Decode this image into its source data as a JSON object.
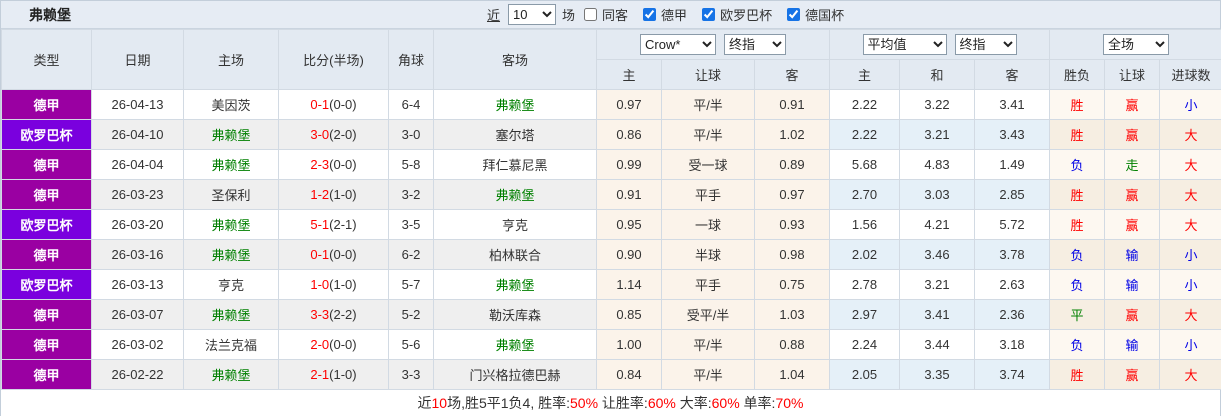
{
  "title": "弗赖堡",
  "toolbar": {
    "near_label": "近",
    "match_count": "10",
    "matches_label": "场",
    "same_away": {
      "label": "同客",
      "checked": false
    },
    "leagues": [
      {
        "label": "德甲",
        "checked": true
      },
      {
        "label": "欧罗巴杯",
        "checked": true
      },
      {
        "label": "德国杯",
        "checked": true
      }
    ]
  },
  "header": {
    "selects": {
      "company": "Crow*",
      "company_stage": "终指",
      "average": "平均值",
      "average_stage": "终指",
      "scope": "全场"
    },
    "columns": {
      "type": "类型",
      "date": "日期",
      "home": "主场",
      "score": "比分(半场)",
      "corner": "角球",
      "away": "客场",
      "odds_home": "主",
      "odds_handicap": "让球",
      "odds_away": "客",
      "avg_home": "主",
      "avg_draw": "和",
      "avg_away": "客",
      "wdl": "胜负",
      "cover": "让球",
      "goals": "进球数"
    }
  },
  "rows": [
    {
      "league": "德甲",
      "league_class": "lg-a",
      "date": "26-04-13",
      "home": "美因茨",
      "home_class": "",
      "score": "0-1",
      "half": "(0-0)",
      "corners": "6-4",
      "away": "弗赖堡",
      "away_class": "team-self",
      "odds_home": "0.97",
      "handicap": "平/半",
      "odds_away": "0.91",
      "avg_home": "2.22",
      "avg_draw": "3.22",
      "avg_away": "3.41",
      "wdl": "胜",
      "wdl_class": "c-red",
      "cover": "赢",
      "cover_class": "c-red",
      "goals": "小",
      "goals_class": "c-blue"
    },
    {
      "league": "欧罗巴杯",
      "league_class": "lg-b",
      "date": "26-04-10",
      "home": "弗赖堡",
      "home_class": "team-self",
      "score": "3-0",
      "half": "(2-0)",
      "corners": "3-0",
      "away": "塞尔塔",
      "away_class": "",
      "odds_home": "0.86",
      "handicap": "平/半",
      "odds_away": "1.02",
      "avg_home": "2.22",
      "avg_draw": "3.21",
      "avg_away": "3.43",
      "wdl": "胜",
      "wdl_class": "c-red",
      "cover": "赢",
      "cover_class": "c-red",
      "goals": "大",
      "goals_class": "c-red"
    },
    {
      "league": "德甲",
      "league_class": "lg-a",
      "date": "26-04-04",
      "home": "弗赖堡",
      "home_class": "team-self",
      "score": "2-3",
      "half": "(0-0)",
      "corners": "5-8",
      "away": "拜仁慕尼黑",
      "away_class": "",
      "odds_home": "0.99",
      "handicap": "受一球",
      "odds_away": "0.89",
      "avg_home": "5.68",
      "avg_draw": "4.83",
      "avg_away": "1.49",
      "wdl": "负",
      "wdl_class": "c-blue",
      "cover": "走",
      "cover_class": "c-green",
      "goals": "大",
      "goals_class": "c-red"
    },
    {
      "league": "德甲",
      "league_class": "lg-a",
      "date": "26-03-23",
      "home": "圣保利",
      "home_class": "",
      "score": "1-2",
      "half": "(1-0)",
      "corners": "3-2",
      "away": "弗赖堡",
      "away_class": "team-self",
      "odds_home": "0.91",
      "handicap": "平手",
      "odds_away": "0.97",
      "avg_home": "2.70",
      "avg_draw": "3.03",
      "avg_away": "2.85",
      "wdl": "胜",
      "wdl_class": "c-red",
      "cover": "赢",
      "cover_class": "c-red",
      "goals": "大",
      "goals_class": "c-red"
    },
    {
      "league": "欧罗巴杯",
      "league_class": "lg-b",
      "date": "26-03-20",
      "home": "弗赖堡",
      "home_class": "team-self",
      "score": "5-1",
      "half": "(2-1)",
      "corners": "3-5",
      "away": "亨克",
      "away_class": "",
      "odds_home": "0.95",
      "handicap": "一球",
      "odds_away": "0.93",
      "avg_home": "1.56",
      "avg_draw": "4.21",
      "avg_away": "5.72",
      "wdl": "胜",
      "wdl_class": "c-red",
      "cover": "赢",
      "cover_class": "c-red",
      "goals": "大",
      "goals_class": "c-red"
    },
    {
      "league": "德甲",
      "league_class": "lg-a",
      "date": "26-03-16",
      "home": "弗赖堡",
      "home_class": "team-self",
      "score": "0-1",
      "half": "(0-0)",
      "corners": "6-2",
      "away": "柏林联合",
      "away_class": "",
      "odds_home": "0.90",
      "handicap": "半球",
      "odds_away": "0.98",
      "avg_home": "2.02",
      "avg_draw": "3.46",
      "avg_away": "3.78",
      "wdl": "负",
      "wdl_class": "c-blue",
      "cover": "输",
      "cover_class": "c-blue",
      "goals": "小",
      "goals_class": "c-blue"
    },
    {
      "league": "欧罗巴杯",
      "league_class": "lg-b",
      "date": "26-03-13",
      "home": "亨克",
      "home_class": "",
      "score": "1-0",
      "half": "(1-0)",
      "corners": "5-7",
      "away": "弗赖堡",
      "away_class": "team-self",
      "odds_home": "1.14",
      "handicap": "平手",
      "odds_away": "0.75",
      "avg_home": "2.78",
      "avg_draw": "3.21",
      "avg_away": "2.63",
      "wdl": "负",
      "wdl_class": "c-blue",
      "cover": "输",
      "cover_class": "c-blue",
      "goals": "小",
      "goals_class": "c-blue"
    },
    {
      "league": "德甲",
      "league_class": "lg-a",
      "date": "26-03-07",
      "home": "弗赖堡",
      "home_class": "team-self",
      "score": "3-3",
      "half": "(2-2)",
      "corners": "5-2",
      "away": "勒沃库森",
      "away_class": "",
      "odds_home": "0.85",
      "handicap": "受平/半",
      "odds_away": "1.03",
      "avg_home": "2.97",
      "avg_draw": "3.41",
      "avg_away": "2.36",
      "wdl": "平",
      "wdl_class": "c-green",
      "cover": "赢",
      "cover_class": "c-red",
      "goals": "大",
      "goals_class": "c-red"
    },
    {
      "league": "德甲",
      "league_class": "lg-a",
      "date": "26-03-02",
      "home": "法兰克福",
      "home_class": "",
      "score": "2-0",
      "half": "(0-0)",
      "corners": "5-6",
      "away": "弗赖堡",
      "away_class": "team-self",
      "odds_home": "1.00",
      "handicap": "平/半",
      "odds_away": "0.88",
      "avg_home": "2.24",
      "avg_draw": "3.44",
      "avg_away": "3.18",
      "wdl": "负",
      "wdl_class": "c-blue",
      "cover": "输",
      "cover_class": "c-blue",
      "goals": "小",
      "goals_class": "c-blue"
    },
    {
      "league": "德甲",
      "league_class": "lg-a",
      "date": "26-02-22",
      "home": "弗赖堡",
      "home_class": "team-self",
      "score": "2-1",
      "half": "(1-0)",
      "corners": "3-3",
      "away": "门兴格拉德巴赫",
      "away_class": "",
      "odds_home": "0.84",
      "handicap": "平/半",
      "odds_away": "1.04",
      "avg_home": "2.05",
      "avg_draw": "3.35",
      "avg_away": "3.74",
      "wdl": "胜",
      "wdl_class": "c-red",
      "cover": "赢",
      "cover_class": "c-red",
      "goals": "大",
      "goals_class": "c-red"
    }
  ],
  "footer": {
    "s1": "近",
    "s2": "10",
    "s3": "场,胜5平1负4, 胜率:",
    "s4": "50%",
    "s5": " 让胜率:",
    "s6": "60%",
    "s7": " 大率:",
    "s8": "60%",
    "s9": " 单率:",
    "s10": "70%"
  },
  "colors": {
    "league_bundesliga_bg": "#9A00A2",
    "league_europa_bg": "#7A00DE",
    "team_highlight": "#008000",
    "score_red": "#FF0000",
    "win_red": "#FF0000",
    "loss_blue": "#0000E6",
    "draw_green": "#008000",
    "header_bg": "#E3EAF2",
    "odds_col_bg": "#FBF3EA",
    "avg_col_stripe_bg": "#E5F0F8",
    "stripe_gray": "#EFEFEF"
  }
}
